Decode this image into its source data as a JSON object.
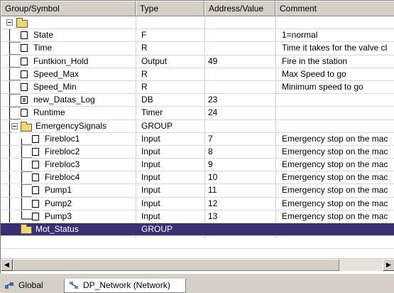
{
  "columns": [
    "Group/Symbol",
    "Type",
    "Address/Value",
    "Comment"
  ],
  "rows": [
    {
      "name": "",
      "type": "",
      "addr": "",
      "comment": ""
    },
    {
      "name": "State",
      "type": "F",
      "addr": "",
      "comment": "1=normal"
    },
    {
      "name": "Time",
      "type": "R",
      "addr": "",
      "comment": "Time it takes for the valve cl"
    },
    {
      "name": "Funtkion_Hold",
      "type": "Output",
      "addr": "49",
      "comment": " Fire in the station"
    },
    {
      "name": "Speed_Max",
      "type": "R",
      "addr": "",
      "comment": "Max Speed to go"
    },
    {
      "name": "Speed_Min",
      "type": "R",
      "addr": "",
      "comment": "Minimum speed to go"
    },
    {
      "name": "new_Datas_Log",
      "type": "DB",
      "addr": "23",
      "comment": ""
    },
    {
      "name": "Runtime",
      "type": "Timer",
      "addr": "24",
      "comment": ""
    },
    {
      "name": "EmergencySignals",
      "type": "GROUP",
      "addr": "",
      "comment": ""
    },
    {
      "name": "Firebloc1",
      "type": "Input",
      "addr": "7",
      "comment": "Emergency stop on the mac"
    },
    {
      "name": "Firebloc2",
      "type": "Input",
      "addr": "8",
      "comment": "Emergency stop on the mac"
    },
    {
      "name": "Firebloc3",
      "type": "Input",
      "addr": "9",
      "comment": "Emergency stop on the mac"
    },
    {
      "name": "Firebloc4",
      "type": "Input",
      "addr": "10",
      "comment": "Emergency stop on the mac"
    },
    {
      "name": "Pump1",
      "type": "Input",
      "addr": "11",
      "comment": "Emergency stop on the mac"
    },
    {
      "name": "Pump2",
      "type": "Input",
      "addr": "12",
      "comment": "Emergency stop on the mac"
    },
    {
      "name": "Pump3",
      "type": "Input",
      "addr": "13",
      "comment": "Emergency stop on the mac"
    },
    {
      "name": "Mot_Status",
      "type": "GROUP",
      "addr": "",
      "comment": ""
    },
    {
      "name": "",
      "type": "",
      "addr": "",
      "comment": ""
    }
  ],
  "tabs": [
    {
      "label": "Global",
      "icon": "global-symbols-icon",
      "active": true
    },
    {
      "label": "DP_Network (Network)",
      "icon": "network-icon",
      "active": false
    }
  ],
  "colors": {
    "selection": "#3a2f70",
    "folder": "#e8d680"
  }
}
